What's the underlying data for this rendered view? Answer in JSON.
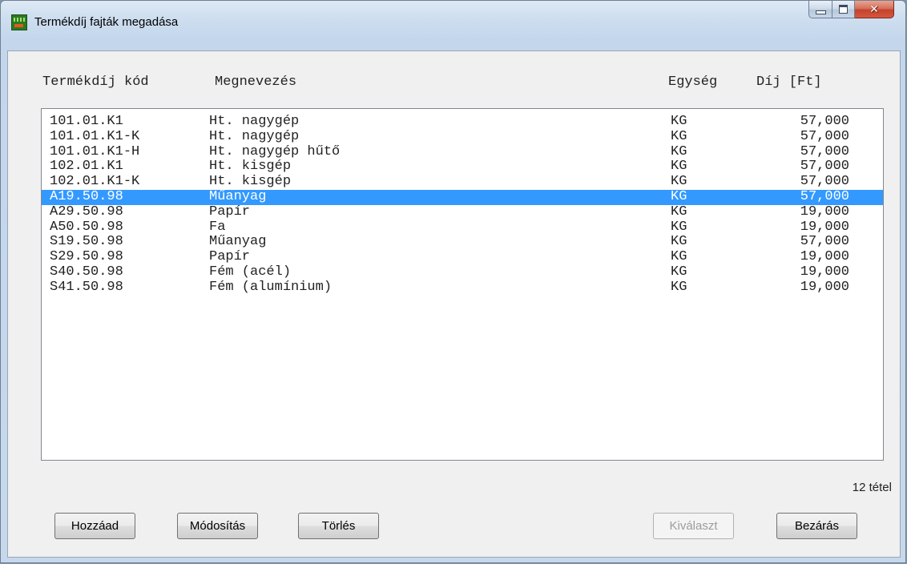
{
  "window": {
    "title": "Termékdíj fajták megadása",
    "caption_buttons": {
      "minimize": "minimize-icon",
      "maximize": "maximize-icon",
      "close": "✕"
    }
  },
  "list": {
    "headers": {
      "code": "Termékdíj kód",
      "name": "Megnevezés",
      "unit": "Egység",
      "fee": "Díj [Ft]"
    },
    "selected_index": 5,
    "rows": [
      {
        "code": "101.01.K1",
        "name": "Ht. nagygép",
        "unit": "KG",
        "fee": "57,000"
      },
      {
        "code": "101.01.K1-K",
        "name": "Ht. nagygép",
        "unit": "KG",
        "fee": "57,000"
      },
      {
        "code": "101.01.K1-H",
        "name": "Ht. nagygép hűtő",
        "unit": "KG",
        "fee": "57,000"
      },
      {
        "code": "102.01.K1",
        "name": "Ht. kisgép",
        "unit": "KG",
        "fee": "57,000"
      },
      {
        "code": "102.01.K1-K",
        "name": "Ht. kisgép",
        "unit": "KG",
        "fee": "57,000"
      },
      {
        "code": "A19.50.98",
        "name": "Műanyag",
        "unit": "KG",
        "fee": "57,000"
      },
      {
        "code": "A29.50.98",
        "name": "Papír",
        "unit": "KG",
        "fee": "19,000"
      },
      {
        "code": "A50.50.98",
        "name": "Fa",
        "unit": "KG",
        "fee": "19,000"
      },
      {
        "code": "S19.50.98",
        "name": "Műanyag",
        "unit": "KG",
        "fee": "57,000"
      },
      {
        "code": "S29.50.98",
        "name": "Papír",
        "unit": "KG",
        "fee": "19,000"
      },
      {
        "code": "S40.50.98",
        "name": "Fém (acél)",
        "unit": "KG",
        "fee": "19,000"
      },
      {
        "code": "S41.50.98",
        "name": "Fém (alumínium)",
        "unit": "KG",
        "fee": "19,000"
      }
    ]
  },
  "count_label": "12 tétel",
  "buttons": {
    "add": "Hozzáad",
    "modify": "Módosítás",
    "delete": "Törlés",
    "select": "Kiválaszt",
    "close": "Bezárás"
  },
  "colors": {
    "selection": "#3399ff",
    "selection_text": "#ffffff"
  }
}
